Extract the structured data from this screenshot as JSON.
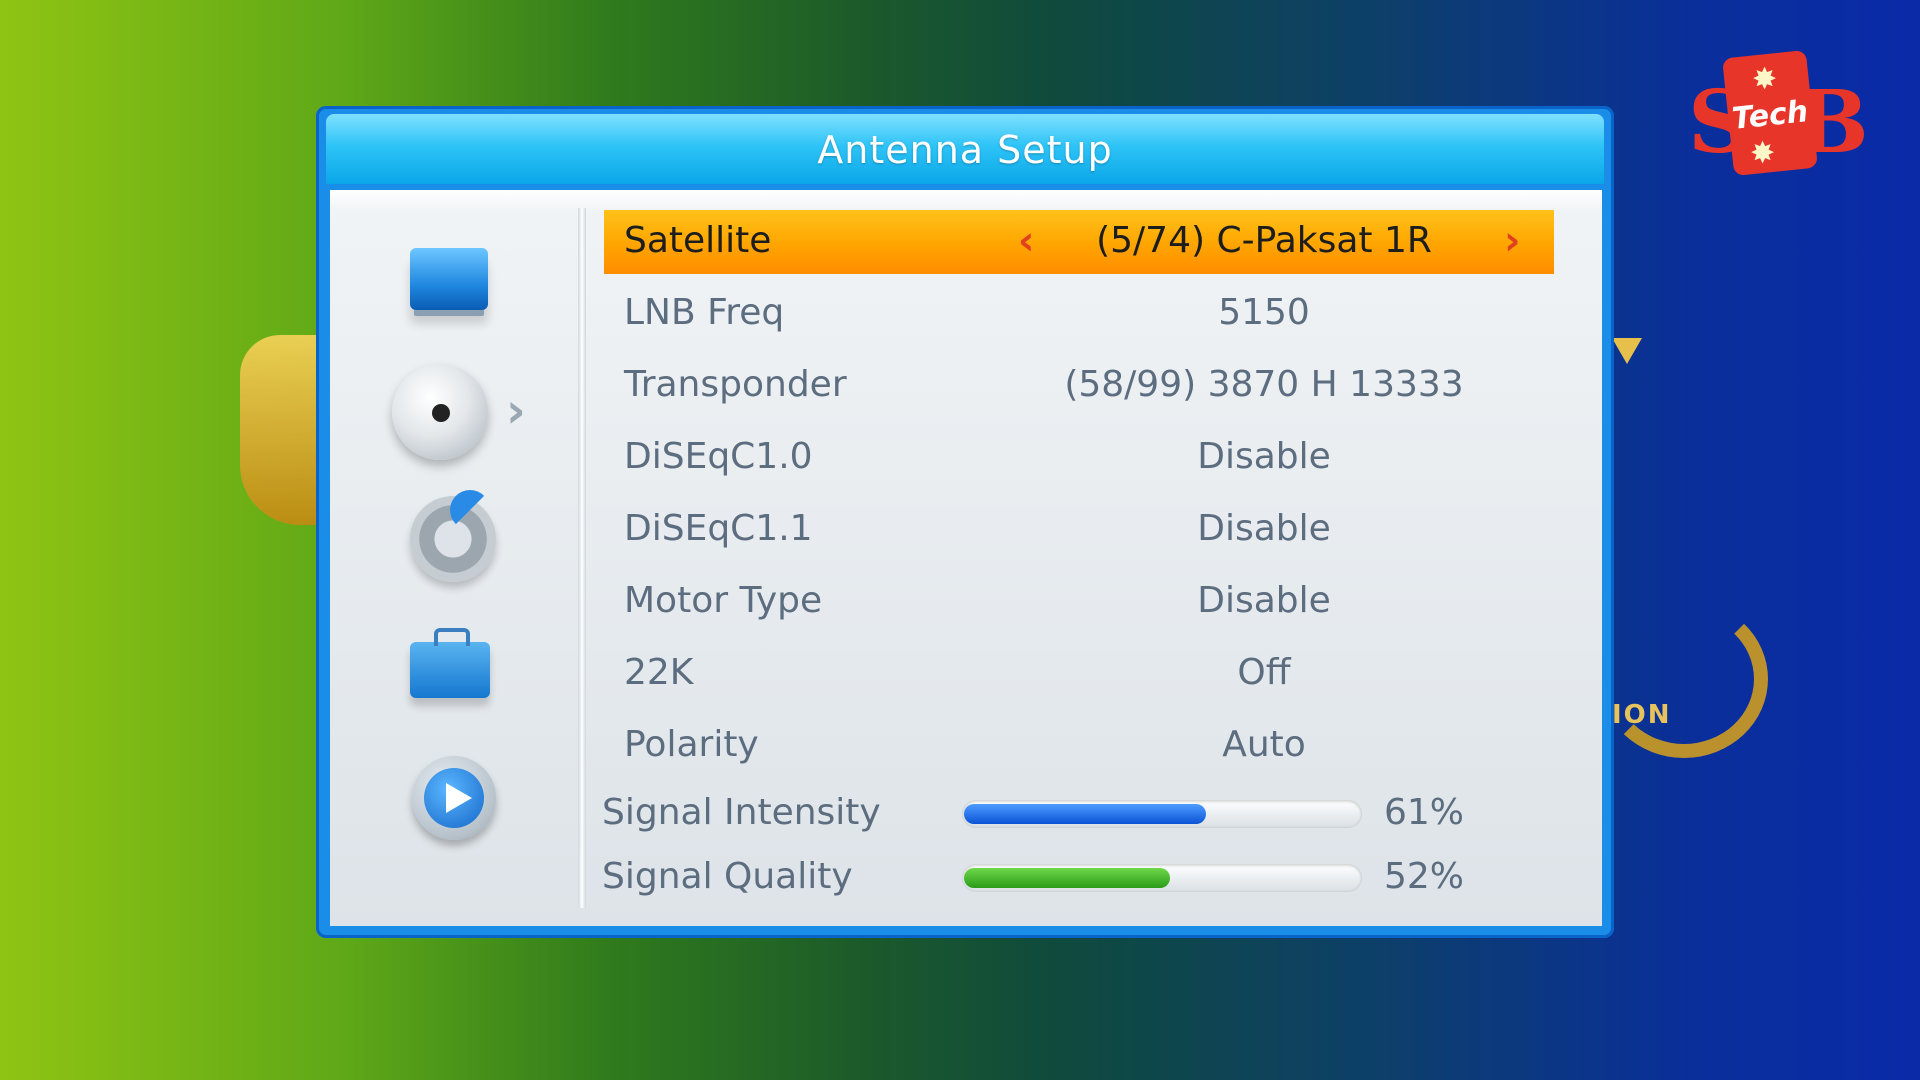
{
  "dialog": {
    "title": "Antenna Setup"
  },
  "sidebar": {
    "items": [
      {
        "icon": "tv-icon"
      },
      {
        "icon": "satellite-dish-icon",
        "active": true
      },
      {
        "icon": "gear-icon"
      },
      {
        "icon": "briefcase-icon"
      },
      {
        "icon": "play-icon"
      }
    ],
    "active_arrow": "›"
  },
  "settings": {
    "satellite": {
      "label": "Satellite",
      "value": "(5/74) C-Paksat 1R",
      "arrow_left": "‹",
      "arrow_right": "›"
    },
    "lnb_freq": {
      "label": "LNB Freq",
      "value": "5150"
    },
    "transponder": {
      "label": "Transponder",
      "value": "(58/99) 3870 H 13333"
    },
    "diseqc10": {
      "label": "DiSEqC1.0",
      "value": "Disable"
    },
    "diseqc11": {
      "label": "DiSEqC1.1",
      "value": "Disable"
    },
    "motor_type": {
      "label": "Motor Type",
      "value": "Disable"
    },
    "k22": {
      "label": "22K",
      "value": "Off"
    },
    "polarity": {
      "label": "Polarity",
      "value": "Auto"
    }
  },
  "signal": {
    "intensity": {
      "label": "Signal Intensity",
      "percent_text": "61%",
      "fraction": 0.61,
      "color": "#0a53d6"
    },
    "quality": {
      "label": "Signal Quality",
      "percent_text": "52%",
      "fraction": 0.52,
      "color": "#2a9b18"
    }
  },
  "logo": {
    "text": "Tech"
  },
  "colors": {
    "selected_row": "#ffa400",
    "title_bar": "#2ec4f7"
  }
}
